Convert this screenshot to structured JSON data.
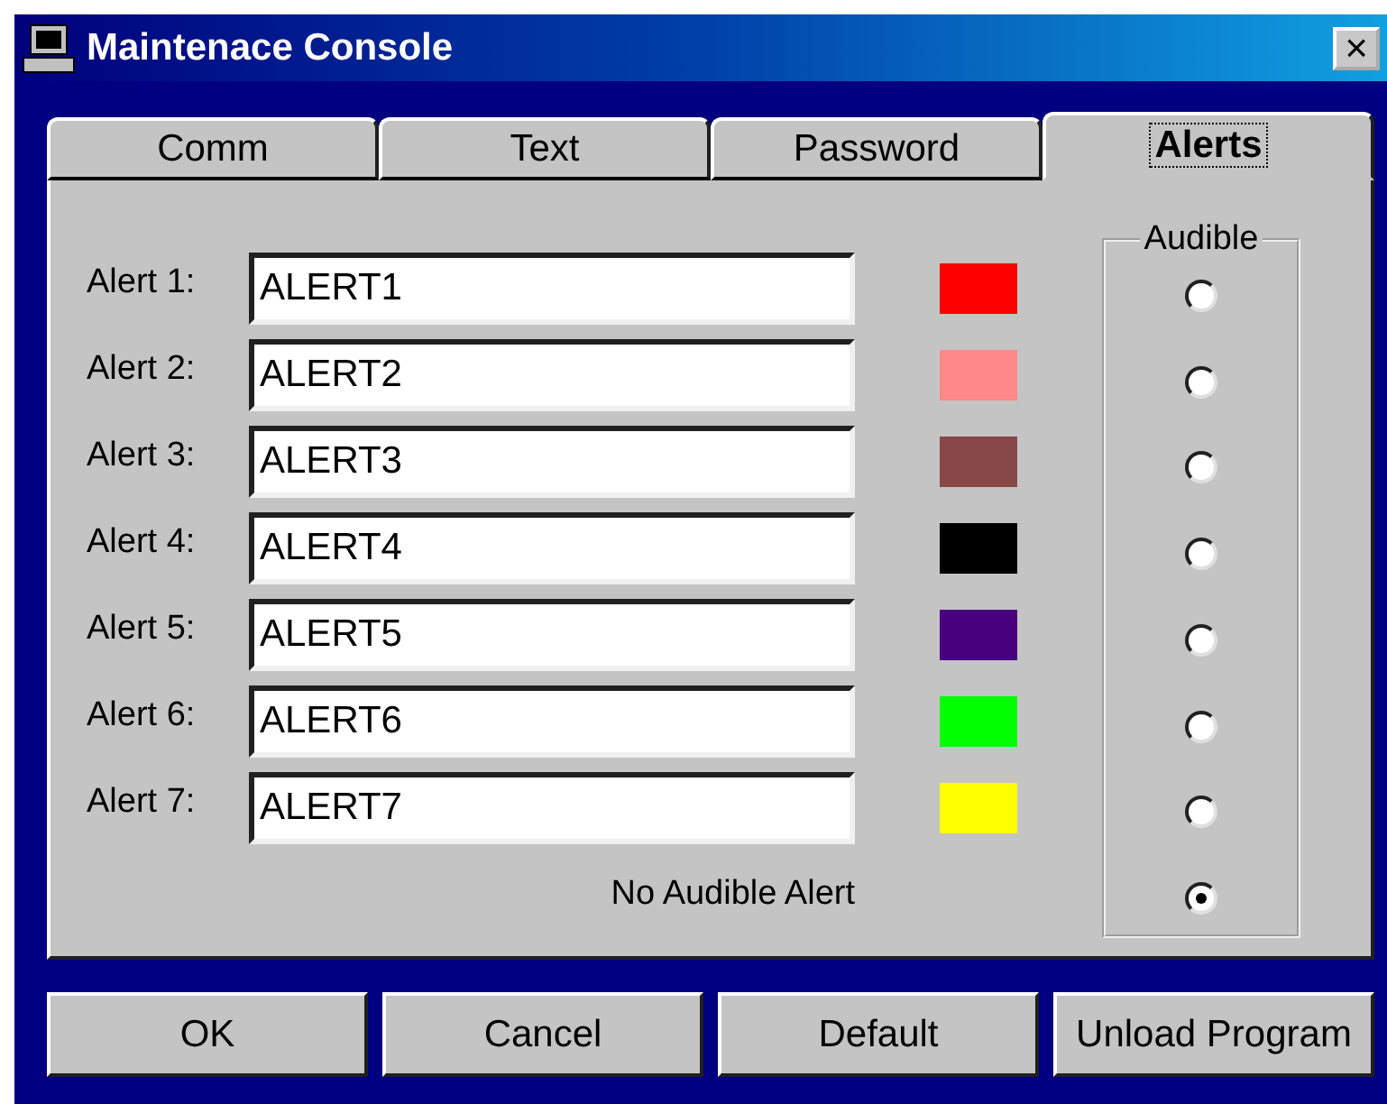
{
  "window": {
    "title": "Maintenace Console",
    "close": "×"
  },
  "tabs": [
    {
      "label": "Comm",
      "selected": false
    },
    {
      "label": "Text",
      "selected": false
    },
    {
      "label": "Password",
      "selected": false
    },
    {
      "label": "Alerts",
      "selected": true
    }
  ],
  "alerts": [
    {
      "label": "Alert 1:",
      "value": "ALERT1",
      "color": "#ff0000",
      "selected": false
    },
    {
      "label": "Alert 2:",
      "value": "ALERT2",
      "color": "#ff8888",
      "selected": false
    },
    {
      "label": "Alert 3:",
      "value": "ALERT3",
      "color": "#884848",
      "selected": false
    },
    {
      "label": "Alert 4:",
      "value": "ALERT4",
      "color": "#000000",
      "selected": false
    },
    {
      "label": "Alert 5:",
      "value": "ALERT5",
      "color": "#48007f",
      "selected": false
    },
    {
      "label": "Alert 6:",
      "value": "ALERT6",
      "color": "#00ff00",
      "selected": false
    },
    {
      "label": "Alert 7:",
      "value": "ALERT7",
      "color": "#ffff00",
      "selected": false
    }
  ],
  "no_audible": {
    "label": "No Audible Alert",
    "selected": true
  },
  "audible_group": {
    "title": "Audible"
  },
  "buttons": [
    "OK",
    "Cancel",
    "Default",
    "Unload Program"
  ]
}
